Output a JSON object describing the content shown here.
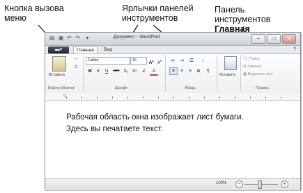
{
  "annotations": {
    "menu_button": {
      "line1": "Кнопка вызова",
      "line2": "меню"
    },
    "tabs": {
      "line1": "Ярлычки панелей",
      "line2": "инструментов"
    },
    "home_panel": {
      "line1": "Панель инструментов",
      "line2": "Главная"
    }
  },
  "window": {
    "title": "Документ - WordPad",
    "quick_access": [
      "▤",
      "↶",
      "↷",
      "▾"
    ],
    "controls": {
      "minimize": "–",
      "maximize": "□",
      "close": "✕"
    }
  },
  "tabs": {
    "menu_button": "▬▾",
    "home": "Главная",
    "view": "Вид",
    "help": "?"
  },
  "ribbon": {
    "clipboard": {
      "paste": "Вставить",
      "label": "Буфер обмена"
    },
    "font": {
      "family": "Calibri",
      "size": "16",
      "grow": "A",
      "shrink": "A",
      "bold": "Ж",
      "italic": "К",
      "underline": "Ч",
      "strike": "abc",
      "subscript": "X₂",
      "superscript": "X²",
      "highlight": "∠",
      "color": "A",
      "label": "Шрифт"
    },
    "paragraph": {
      "label": "Абзац"
    },
    "insert": {
      "label": "Вставить"
    },
    "edit": {
      "find": "Поиск",
      "replace": "Замена",
      "select_all": "Выделить все",
      "label": "Правка"
    }
  },
  "document": {
    "line1": "Рабочая область окна изображает лист бумаги.",
    "line2": "Здесь вы печатаете текст."
  },
  "status": {
    "zoom": "100%",
    "minus": "−",
    "plus": "+"
  }
}
